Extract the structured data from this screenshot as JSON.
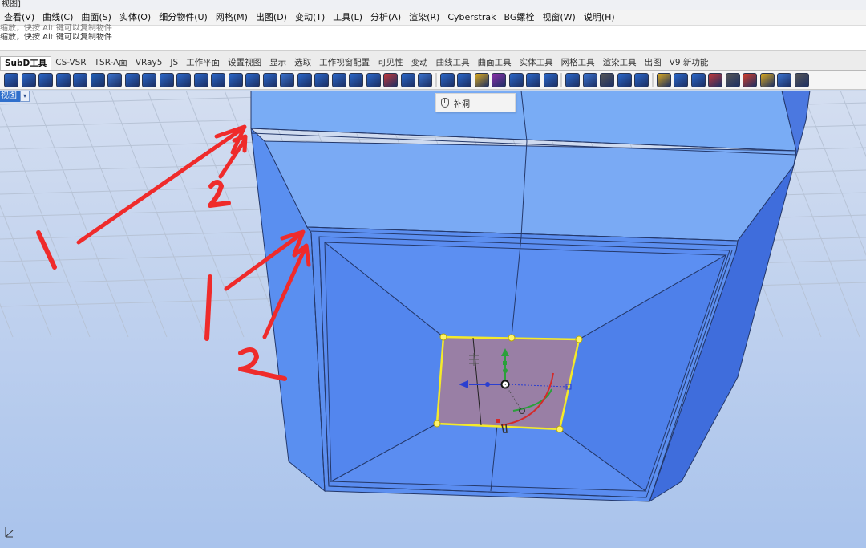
{
  "window": {
    "title": "视图]"
  },
  "menubar": {
    "items": [
      "查看(V)",
      "曲线(C)",
      "曲面(S)",
      "实体(O)",
      "细分物件(U)",
      "网格(M)",
      "出图(D)",
      "变动(T)",
      "工具(L)",
      "分析(A)",
      "渲染(R)",
      "Cyberstrak",
      "BG螺栓",
      "视窗(W)",
      "说明(H)"
    ]
  },
  "command_history": {
    "lines": [
      "缩放，快按 Alt 键可以复制物件",
      "缩放，快按 Alt 键可以复制物件"
    ]
  },
  "tabs": {
    "items": [
      "SubD工具",
      "CS-VSR",
      "TSR-A面",
      "VRay5",
      "JS",
      "工作平面",
      "设置视图",
      "显示",
      "选取",
      "工作视窗配置",
      "可见性",
      "变动",
      "曲线工具",
      "曲面工具",
      "实体工具",
      "网格工具",
      "渲染工具",
      "出图",
      "V9 新功能"
    ],
    "active": "SubD工具"
  },
  "toolbar": {
    "buttons": [
      {
        "icon": "subd-cylinder-icon",
        "color": "#2a67c9"
      },
      {
        "icon": "subd-sphere-icon",
        "color": "#2a67c9"
      },
      {
        "icon": "subd-ellipsoid-icon",
        "color": "#2a67c9"
      },
      {
        "icon": "subd-torus-icon",
        "color": "#2a67c9"
      },
      {
        "icon": "subd-box-icon",
        "color": "#2a67c9"
      },
      {
        "icon": "subd-cone-icon",
        "color": "#1f5fb8"
      },
      {
        "icon": "subd-fillet-icon",
        "color": "#3a73cf"
      },
      {
        "icon": "subd-loft-icon",
        "color": "#2a67c9"
      },
      {
        "icon": "subd-pipe-icon",
        "color": "#2a67c9"
      },
      {
        "icon": "subd-patch-icon",
        "color": "#2a67c9"
      },
      {
        "icon": "subd-extrude-icon",
        "color": "#2a67c9"
      },
      {
        "icon": "subd-bridge-icon",
        "color": "#2a67c9"
      },
      {
        "icon": "subd-crease-icon",
        "color": "#2a67c9"
      },
      {
        "icon": "subd-insert-point-icon",
        "color": "#2a67c9"
      },
      {
        "icon": "subd-offset-icon",
        "color": "#2a67c9"
      },
      {
        "icon": "subd-bevel-icon",
        "color": "#2a67c9"
      },
      {
        "icon": "subd-quad-remesh-icon",
        "color": "#3a73cf"
      },
      {
        "icon": "subd-stitch-icon",
        "color": "#2a67c9"
      },
      {
        "icon": "subd-grid-icon",
        "color": "#2a67c9"
      },
      {
        "icon": "subd-slide-icon",
        "color": "#2a67c9"
      },
      {
        "icon": "subd-merge-icon",
        "color": "#2a67c9"
      },
      {
        "icon": "subd-star-icon",
        "color": "#2a67c9"
      },
      {
        "icon": "subd-align-icon",
        "color": "#c2383a"
      },
      {
        "icon": "subd-fill-hole-icon",
        "color": "#2a67c9"
      },
      {
        "icon": "subd-append-icon",
        "color": "#3a73cf"
      },
      {
        "icon": "subd-refine-icon",
        "color": "#2a67c9"
      },
      {
        "icon": "subd-to-nurbs-icon",
        "color": "#2a67c9"
      },
      {
        "icon": "subd-display-icon",
        "color": "#d9a81e"
      },
      {
        "icon": "subd-box-mode-icon",
        "color": "#8a2fa8"
      },
      {
        "icon": "subd-flip-icon",
        "color": "#2a67c9"
      },
      {
        "icon": "subd-dots-icon",
        "color": "#2a67c9"
      },
      {
        "icon": "subd-mesh-icon",
        "color": "#2a67c9"
      },
      {
        "icon": "subd-weld-icon",
        "color": "#2a67c9"
      },
      {
        "icon": "subd-sweep-icon",
        "color": "#3a73cf"
      },
      {
        "icon": "subd-list-icon",
        "color": "#555555"
      },
      {
        "icon": "subd-tools-icon",
        "color": "#2a67c9"
      },
      {
        "icon": "subd-transform-icon",
        "color": "#2a67c9"
      },
      {
        "icon": "subd-sphere-gold-icon",
        "color": "#d9a81e"
      },
      {
        "icon": "subd-sphere-blue-icon",
        "color": "#2a67c9"
      },
      {
        "icon": "subd-sphere-cut-icon",
        "color": "#2a67c9"
      },
      {
        "icon": "subd-no-entry-icon",
        "color": "#c2383a"
      },
      {
        "icon": "subd-bracket-icon",
        "color": "#555555"
      },
      {
        "icon": "subd-arrow-red-icon",
        "color": "#d23d2b"
      },
      {
        "icon": "subd-gear-icon",
        "color": "#d9a81e"
      },
      {
        "icon": "subd-paint-icon",
        "color": "#3a73cf"
      },
      {
        "icon": "subd-layers-icon",
        "color": "#555555"
      }
    ]
  },
  "viewport": {
    "label": "视图",
    "tooltip": "补洞"
  },
  "annotations": {
    "labels": [
      "1",
      "2",
      "1",
      "2"
    ]
  },
  "colors": {
    "accent": "#2f6fcc",
    "model_face": "#5b8cf0",
    "annotation": "#ef2b2b",
    "selection": "#ffeb2c"
  }
}
